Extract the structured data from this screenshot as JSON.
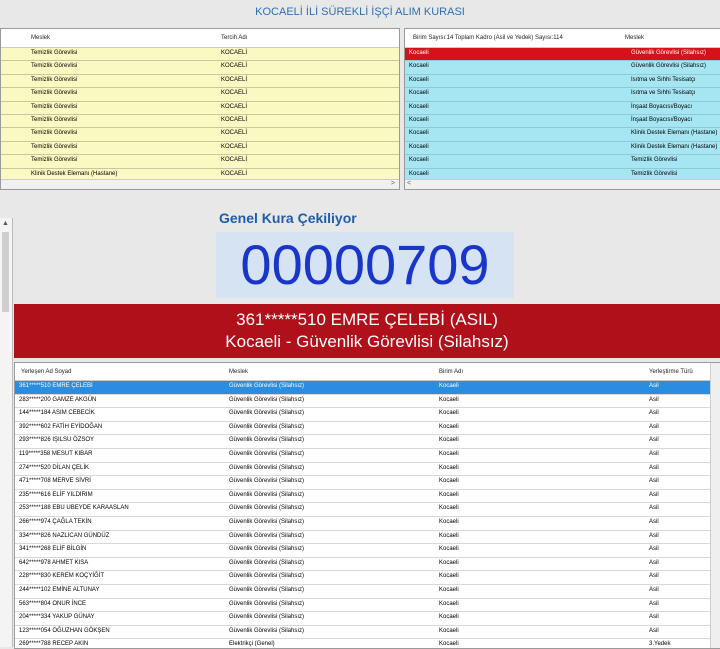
{
  "title": "KOCAELİ İLİ SÜREKLİ İŞÇİ ALIM KURASI",
  "left_grid": {
    "headers": [
      "Meslek",
      "Tercih Adı"
    ],
    "rows": [
      [
        "Temizlik Görevlisi",
        "KOCAELİ"
      ],
      [
        "Temizlik Görevlisi",
        "KOCAELİ"
      ],
      [
        "Temizlik Görevlisi",
        "KOCAELİ"
      ],
      [
        "Temizlik Görevlisi",
        "KOCAELİ"
      ],
      [
        "Temizlik Görevlisi",
        "KOCAELİ"
      ],
      [
        "Temizlik Görevlisi",
        "KOCAELİ"
      ],
      [
        "Temizlik Görevlisi",
        "KOCAELİ"
      ],
      [
        "Temizlik Görevlisi",
        "KOCAELİ"
      ],
      [
        "Temizlik Görevlisi",
        "KOCAELİ"
      ],
      [
        "Klinik Destek Elemanı (Hastane)",
        "KOCAELİ"
      ]
    ]
  },
  "right_grid": {
    "headers": [
      "Birim Sayısı:14 Toplam Kadro (Asil ve Yedek) Sayısı:114",
      "Meslek"
    ],
    "rows": [
      [
        "Kocaeli",
        "Güvenlik Görevlisi (Silahsız)"
      ],
      [
        "Kocaeli",
        "Güvenlik Görevlisi (Silahsız)"
      ],
      [
        "Kocaeli",
        "Isıtma ve Sıhhi Tesisatçı"
      ],
      [
        "Kocaeli",
        "Isıtma ve Sıhhi Tesisatçı"
      ],
      [
        "Kocaeli",
        "İnşaat Boyacısı/Boyacı"
      ],
      [
        "Kocaeli",
        "İnşaat Boyacısı/Boyacı"
      ],
      [
        "Kocaeli",
        "Klinik Destek Elemanı (Hastane)"
      ],
      [
        "Kocaeli",
        "Klinik Destek Elemanı (Hastane)"
      ],
      [
        "Kocaeli",
        "Temizlik Görevlisi"
      ],
      [
        "Kocaeli",
        "Temizlik Görevlisi"
      ]
    ]
  },
  "draw": {
    "heading": "Genel Kura Çekiliyor",
    "number": "00000709",
    "winner_line1": "361*****510 EMRE ÇELEBİ (ASIL)",
    "winner_line2": "Kocaeli - Güvenlik Görevlisi (Silahsız)"
  },
  "bottom_grid": {
    "headers": [
      "Yerleşen Ad Soyad",
      "Meslek",
      "Birim Adı",
      "Yerleştirme Türü"
    ],
    "rows": [
      [
        "361*****510 EMRE ÇELEBİ",
        "Güvenlik Görevlisi (Silahsız)",
        "Kocaeli",
        "Asil"
      ],
      [
        "283*****200 GAMZE AKGÜN",
        "Güvenlik Görevlisi (Silahsız)",
        "Kocaeli",
        "Asil"
      ],
      [
        "144*****184 ASIM CEBECİK",
        "Güvenlik Görevlisi (Silahsız)",
        "Kocaeli",
        "Asil"
      ],
      [
        "392*****602 FATİH EYİDOĞAN",
        "Güvenlik Görevlisi (Silahsız)",
        "Kocaeli",
        "Asil"
      ],
      [
        "293*****826 IŞILSU ÖZSOY",
        "Güvenlik Görevlisi (Silahsız)",
        "Kocaeli",
        "Asil"
      ],
      [
        "119*****358 MESUT KIBAR",
        "Güvenlik Görevlisi (Silahsız)",
        "Kocaeli",
        "Asil"
      ],
      [
        "274*****520 DİLAN ÇELİK",
        "Güvenlik Görevlisi (Silahsız)",
        "Kocaeli",
        "Asil"
      ],
      [
        "471*****708 MERVE SİVRİ",
        "Güvenlik Görevlisi (Silahsız)",
        "Kocaeli",
        "Asil"
      ],
      [
        "235*****616 ELİF YILDIRIM",
        "Güvenlik Görevlisi (Silahsız)",
        "Kocaeli",
        "Asil"
      ],
      [
        "253*****188 EBU UBEYDE KARAASLAN",
        "Güvenlik Görevlisi (Silahsız)",
        "Kocaeli",
        "Asil"
      ],
      [
        "266*****974 ÇAĞLA TEKİN",
        "Güvenlik Görevlisi (Silahsız)",
        "Kocaeli",
        "Asil"
      ],
      [
        "334*****826 NAZLICAN GÜNDÜZ",
        "Güvenlik Görevlisi (Silahsız)",
        "Kocaeli",
        "Asil"
      ],
      [
        "341*****268 ELİF BİLGİN",
        "Güvenlik Görevlisi (Silahsız)",
        "Kocaeli",
        "Asil"
      ],
      [
        "642*****978 AHMET KISA",
        "Güvenlik Görevlisi (Silahsız)",
        "Kocaeli",
        "Asil"
      ],
      [
        "228*****830 KEREM KOÇYİĞİT",
        "Güvenlik Görevlisi (Silahsız)",
        "Kocaeli",
        "Asil"
      ],
      [
        "244*****102 EMİNE ALTUNAY",
        "Güvenlik Görevlisi (Silahsız)",
        "Kocaeli",
        "Asil"
      ],
      [
        "563*****804 ONUR İNCE",
        "Güvenlik Görevlisi (Silahsız)",
        "Kocaeli",
        "Asil"
      ],
      [
        "204*****334 YAKUP GÜNAY",
        "Güvenlik Görevlisi (Silahsız)",
        "Kocaeli",
        "Asil"
      ],
      [
        "123*****054 OĞUZHAN GÖKŞEN",
        "Güvenlik Görevlisi (Silahsız)",
        "Kocaeli",
        "Asil"
      ],
      [
        "269*****788 RECEP AKIN",
        "Elektrikçi (Genel)",
        "Kocaeli",
        "3.Yedek"
      ]
    ]
  },
  "colors": {
    "title_text": "#2e6fb3",
    "number_text": "#1a35c9",
    "banner_bg": "#b0101a",
    "selected_red": "#d7111a",
    "selected_blue": "#2a8de0",
    "left_row_bg": "#fbf9c2",
    "right_row_bg": "#a6e6f2"
  }
}
